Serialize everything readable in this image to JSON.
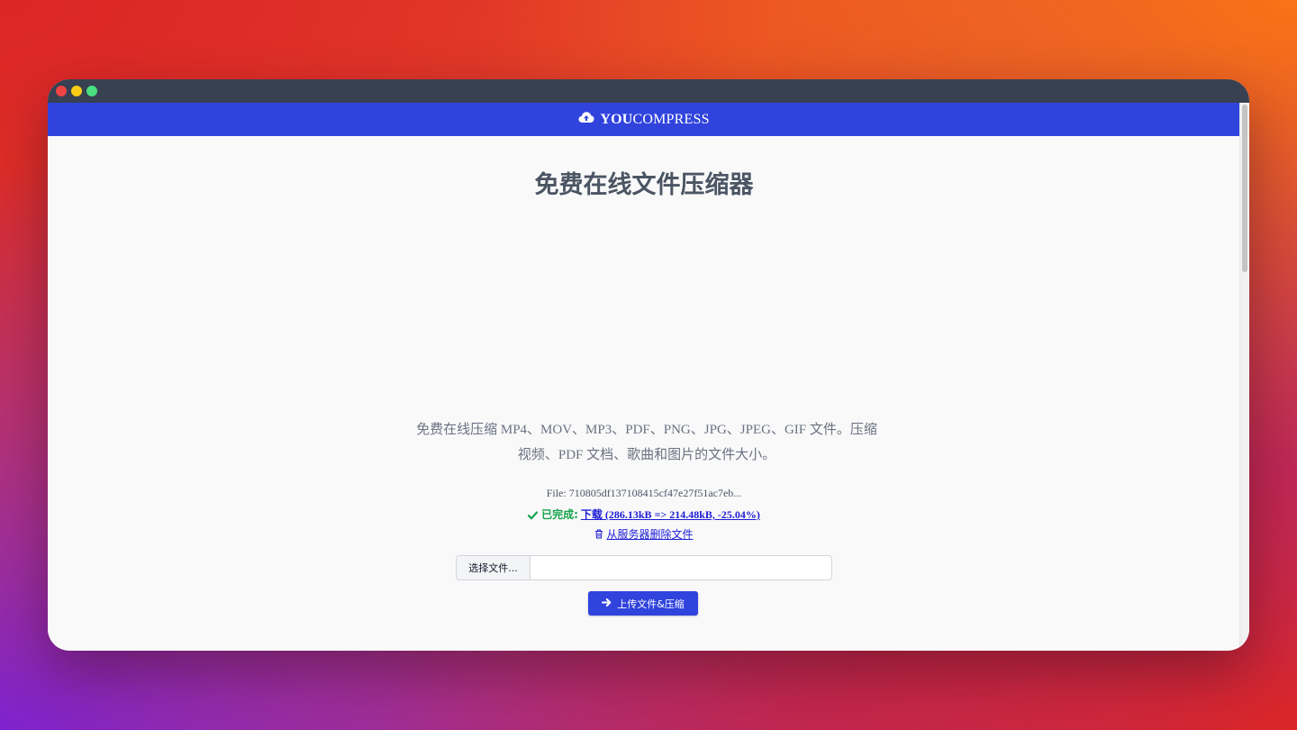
{
  "window": {
    "controls": [
      "close",
      "minimize",
      "maximize"
    ]
  },
  "navbar": {
    "brand_bold": "YOU",
    "brand_rest": "COMPRESS",
    "icon": "cloud-upload-icon",
    "color": "#3043dc"
  },
  "main": {
    "title": "免费在线文件压缩器",
    "description": "免费在线压缩 MP4、MOV、MP3、PDF、PNG、JPG、JPEG、GIF 文件。压缩视频、PDF 文档、歌曲和图片的文件大小。",
    "file_label": "File: 710805df137108415cf47e27f51ac7eb...",
    "status_label": "已完成:",
    "download_link": "下载 (286.13kB => 214.48kB, -25.04%)",
    "delete_link": "从服务器删除文件",
    "choose_file_label": "选择文件...",
    "file_name_value": "",
    "upload_button_label": "上传文件&压缩"
  },
  "colors": {
    "accent": "#3043dc",
    "success": "#16a34a",
    "link": "#1d1dd6"
  }
}
